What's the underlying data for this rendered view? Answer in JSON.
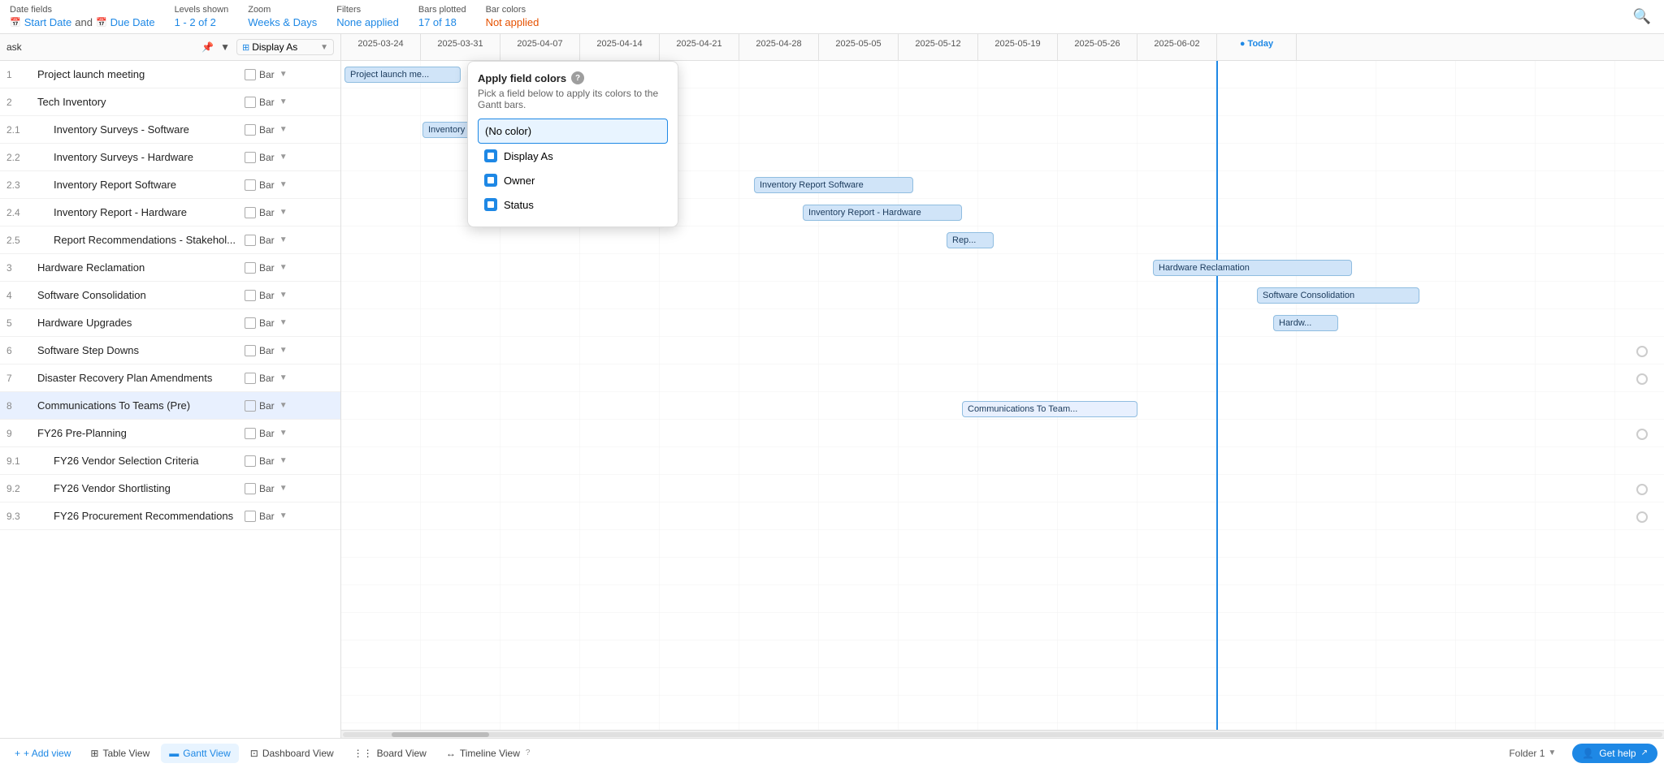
{
  "toolbar": {
    "date_fields_label": "Date fields",
    "start_date": "Start Date",
    "and": "and",
    "due_date": "Due Date",
    "levels_label": "Levels shown",
    "levels_value": "1 - 2 of 2",
    "zoom_label": "Zoom",
    "zoom_value": "Weeks & Days",
    "filters_label": "Filters",
    "filters_value": "None applied",
    "bars_label": "Bars plotted",
    "bars_value": "17 of 18",
    "colors_label": "Bar colors",
    "colors_value": "Not applied"
  },
  "gantt_header": {
    "task_col": "ask",
    "display_col": "Display As",
    "dates": [
      "2025-03-24",
      "2025-03-31",
      "2025-04-07",
      "2025-04-14",
      "2025-04-21",
      "2025-04-28",
      "2025-05-05",
      "2025-05-12",
      "2025-05-19",
      "2025-05-26",
      "2025-06-02",
      "Today"
    ]
  },
  "tasks": [
    {
      "num": "1",
      "name": "Project launch meeting",
      "indented": false,
      "type": "Bar",
      "highlighted": false,
      "bar": {
        "label": "Project launch me...",
        "col_start": 0,
        "col_width": 1.5
      }
    },
    {
      "num": "2",
      "name": "Tech Inventory",
      "indented": false,
      "type": "Bar",
      "highlighted": false,
      "bar": null
    },
    {
      "num": "2.1",
      "name": "Inventory Surveys - Software",
      "indented": true,
      "type": "Bar",
      "highlighted": false,
      "bar": {
        "label": "Inventory Surveys -...",
        "col_start": 1,
        "col_width": 1.2
      }
    },
    {
      "num": "2.2",
      "name": "Inventory Surveys - Hardware",
      "indented": true,
      "type": "Bar",
      "highlighted": false,
      "bar": null
    },
    {
      "num": "2.3",
      "name": "Inventory Report Software",
      "indented": true,
      "type": "Bar",
      "highlighted": false,
      "bar": {
        "label": "Inventory Report Software",
        "col_start": 5.2,
        "col_width": 2.0
      }
    },
    {
      "num": "2.4",
      "name": "Inventory Report - Hardware",
      "indented": true,
      "type": "Bar",
      "highlighted": false,
      "bar": {
        "label": "Inventory Report - Hardware",
        "col_start": 5.8,
        "col_width": 2.0
      }
    },
    {
      "num": "2.5",
      "name": "Report Recommendations - Stakehol...",
      "indented": true,
      "type": "Bar",
      "highlighted": false,
      "bar": {
        "label": "Rep...",
        "col_start": 7.6,
        "col_width": 0.6
      }
    },
    {
      "num": "3",
      "name": "Hardware Reclamation",
      "indented": false,
      "type": "Bar",
      "highlighted": false,
      "bar": {
        "label": "Hardware Reclamation",
        "col_start": 10.2,
        "col_width": 2.5
      }
    },
    {
      "num": "4",
      "name": "Software Consolidation",
      "indented": false,
      "type": "Bar",
      "highlighted": false,
      "bar": {
        "label": "Software Consolidation",
        "col_start": 11.5,
        "col_width": 2.0
      }
    },
    {
      "num": "5",
      "name": "Hardware Upgrades",
      "indented": false,
      "type": "Bar",
      "highlighted": false,
      "bar": {
        "label": "Hardw...",
        "col_start": 11.7,
        "col_width": 1.0
      }
    },
    {
      "num": "6",
      "name": "Software Step Downs",
      "indented": false,
      "type": "Bar",
      "highlighted": false,
      "bar": null,
      "circle": true
    },
    {
      "num": "7",
      "name": "Disaster Recovery Plan Amendments",
      "indented": false,
      "type": "Bar",
      "highlighted": false,
      "bar": null,
      "circle": true
    },
    {
      "num": "8",
      "name": "Communications To Teams (Pre)",
      "indented": false,
      "type": "Bar",
      "highlighted": true,
      "bar": {
        "label": "Communications To Team...",
        "col_start": 7.8,
        "col_width": 2.2
      }
    },
    {
      "num": "9",
      "name": "FY26 Pre-Planning",
      "indented": false,
      "type": "Bar",
      "highlighted": false,
      "bar": null,
      "circle": true
    },
    {
      "num": "9.1",
      "name": "FY26 Vendor Selection Criteria",
      "indented": true,
      "type": "Bar",
      "highlighted": false,
      "bar": null
    },
    {
      "num": "9.2",
      "name": "FY26 Vendor Shortlisting",
      "indented": true,
      "type": "Bar",
      "highlighted": false,
      "bar": null
    },
    {
      "num": "9.3",
      "name": "FY26 Procurement Recommendations",
      "indented": true,
      "type": "Bar",
      "highlighted": false,
      "bar": null
    }
  ],
  "popup": {
    "title": "Apply field colors",
    "subtitle": "Pick a field below to apply its colors to the Gantt bars.",
    "no_color": "(No color)",
    "options": [
      {
        "label": "Display As",
        "key": "display_as"
      },
      {
        "label": "Owner",
        "key": "owner"
      },
      {
        "label": "Status",
        "key": "status"
      }
    ]
  },
  "bottom_bar": {
    "add_view": "+ Add view",
    "tabs": [
      {
        "label": "Table View",
        "icon": "table",
        "active": false
      },
      {
        "label": "Gantt View",
        "icon": "gantt",
        "active": true
      },
      {
        "label": "Dashboard View",
        "icon": "dashboard",
        "active": false
      },
      {
        "label": "Board View",
        "icon": "board",
        "active": false
      },
      {
        "label": "Timeline View",
        "icon": "timeline",
        "active": false
      }
    ],
    "folder": "Folder 1",
    "help": "Get help"
  }
}
